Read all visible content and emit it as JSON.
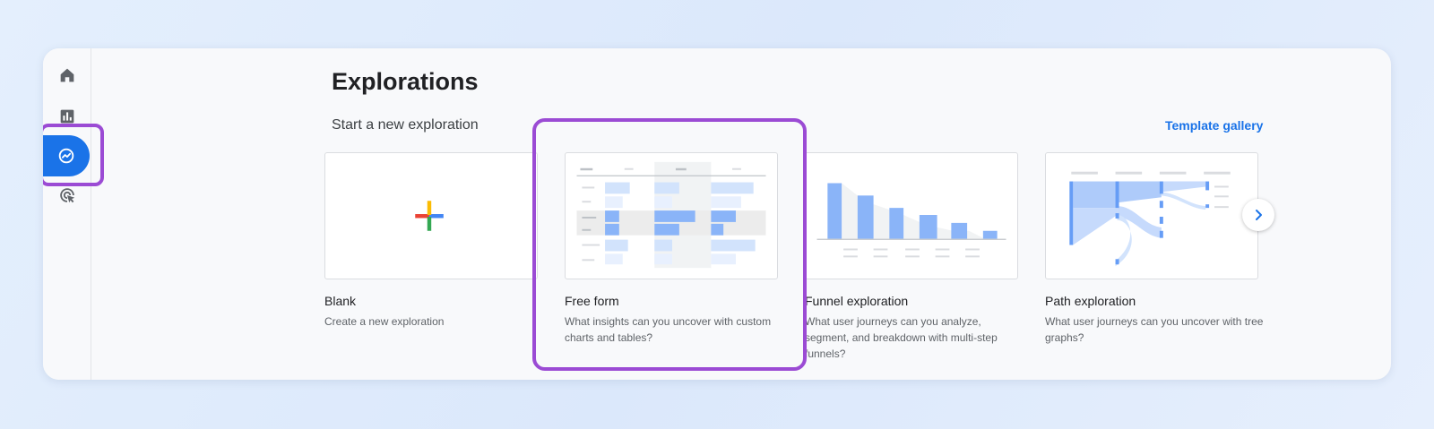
{
  "nav": {
    "items": [
      {
        "name": "home",
        "icon": "home-icon"
      },
      {
        "name": "reports",
        "icon": "bar-chart-icon"
      },
      {
        "name": "explore",
        "icon": "explore-icon",
        "active": true
      },
      {
        "name": "advertising",
        "icon": "cursor-target-icon"
      }
    ]
  },
  "page": {
    "title": "Explorations",
    "section_title": "Start a new exploration",
    "template_gallery": "Template gallery"
  },
  "cards": [
    {
      "title": "Blank",
      "description": "Create a new exploration"
    },
    {
      "title": "Free form",
      "description": "What insights can you uncover with custom charts and tables?"
    },
    {
      "title": "Funnel exploration",
      "description": "What user journeys can you analyze, segment, and breakdown with multi-step funnels?"
    },
    {
      "title": "Path exploration",
      "description": "What user journeys can you uncover with tree graphs?"
    }
  ],
  "colors": {
    "accent": "#1a73e8",
    "highlight": "#9b4bd4",
    "chart_blue": "#8ab4f8",
    "chart_light": "#d2e3fc"
  }
}
